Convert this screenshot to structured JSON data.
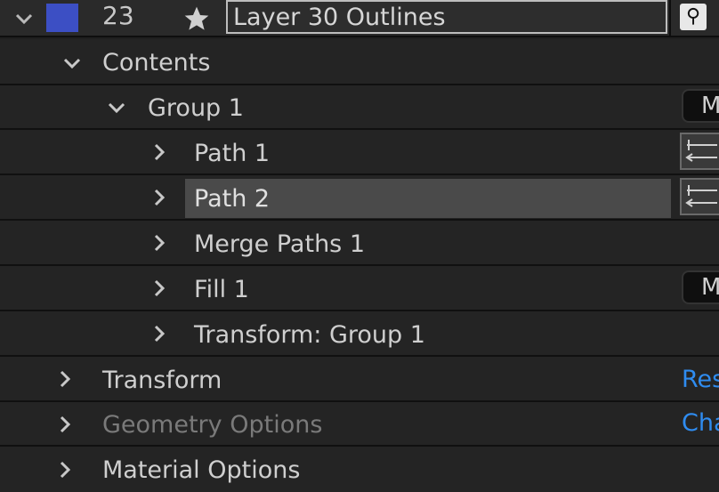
{
  "layer": {
    "number": "23",
    "name": "Layer 30 Outlines",
    "label_color": "#3c4fc4"
  },
  "tree": {
    "contents": "Contents",
    "group1": "Group 1",
    "path1": "Path 1",
    "path2": "Path 2",
    "merge_paths1": "Merge Paths 1",
    "fill1": "Fill 1",
    "transform_group1": "Transform: Group 1",
    "transform": "Transform",
    "geometry_options": "Geometry Options",
    "material_options": "Material Options"
  },
  "right_column": {
    "group_mode": "M",
    "fill_mode": "M",
    "transform_link": "Res",
    "geometry_link": "Cha"
  },
  "icons": {
    "parent_pick_whip": "parent-link-icon",
    "star": "star-icon",
    "path_trim": "path-direction-icon"
  },
  "colors": {
    "accent_blue": "#2f8cf0",
    "selected_row": "#4a4a4a"
  }
}
